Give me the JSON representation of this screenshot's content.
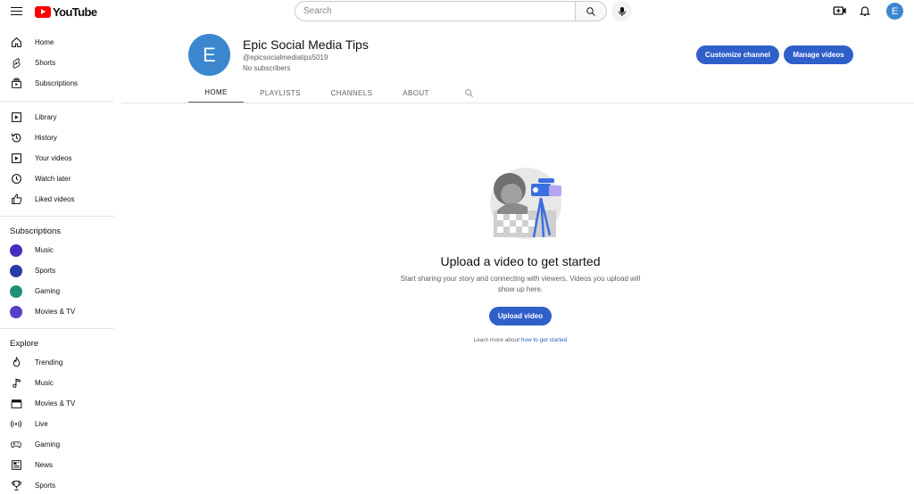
{
  "header": {
    "logo_text": "YouTube",
    "search_placeholder": "Search",
    "avatar_initial": "E"
  },
  "sidebar": {
    "primary": [
      {
        "label": "Home",
        "icon": "home-icon"
      },
      {
        "label": "Shorts",
        "icon": "shorts-icon"
      },
      {
        "label": "Subscriptions",
        "icon": "subscriptions-icon"
      }
    ],
    "library": [
      {
        "label": "Library",
        "icon": "library-icon"
      },
      {
        "label": "History",
        "icon": "history-icon"
      },
      {
        "label": "Your videos",
        "icon": "your-videos-icon"
      },
      {
        "label": "Watch later",
        "icon": "watch-later-icon"
      },
      {
        "label": "Liked videos",
        "icon": "thumbs-up-icon"
      }
    ],
    "subscriptions_heading": "Subscriptions",
    "subscriptions": [
      {
        "label": "Music",
        "color": "#4a2bbf"
      },
      {
        "label": "Sports",
        "color": "#2b3aa8"
      },
      {
        "label": "Gaming",
        "color": "#1e8f7a"
      },
      {
        "label": "Movies & TV",
        "color": "#5b3ec8"
      }
    ],
    "explore_heading": "Explore",
    "explore": [
      {
        "label": "Trending",
        "icon": "trending-icon"
      },
      {
        "label": "Music",
        "icon": "music-note-icon"
      },
      {
        "label": "Movies & TV",
        "icon": "clapperboard-icon"
      },
      {
        "label": "Live",
        "icon": "live-icon"
      },
      {
        "label": "Gaming",
        "icon": "gamepad-icon"
      },
      {
        "label": "News",
        "icon": "news-icon"
      },
      {
        "label": "Sports",
        "icon": "trophy-icon"
      }
    ]
  },
  "channel": {
    "avatar_initial": "E",
    "name": "Epic Social Media Tips",
    "handle": "@epicsocialmediatips5019",
    "subscribers": "No subscribers",
    "customize_label": "Customize channel",
    "manage_label": "Manage videos",
    "tabs": [
      "HOME",
      "PLAYLISTS",
      "CHANNELS",
      "ABOUT"
    ]
  },
  "empty_state": {
    "title": "Upload a video to get started",
    "description": "Start sharing your story and connecting with viewers. Videos you upload will show up here.",
    "upload_label": "Upload video",
    "learn_prefix": "Learn more about ",
    "learn_link": "how to get started"
  },
  "colors": {
    "accent": "#2f5fc9",
    "brand": "#ff0000",
    "avatar": "#3a87d0"
  }
}
